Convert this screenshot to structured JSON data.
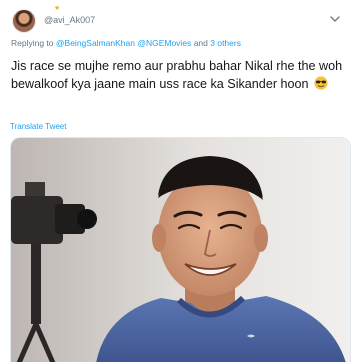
{
  "tweet": {
    "handle": "@avi_Ak007",
    "reply_prefix": "Replying to",
    "reply_user_1": "@BeingSalmanKhan",
    "reply_user_2": "@NGEMovies",
    "reply_and": "and",
    "reply_others": "3 others",
    "text": "Jis race se mujhe remo aur prabhu bahar Nikal rhe the woh bewalkoof kya jaane main uss race ka Sikander hoon",
    "emoji": "smiling-face-with-sunglasses",
    "translate_label": "Translate Tweet"
  },
  "icons": {
    "star": "star-icon",
    "more": "chevron-down-icon"
  },
  "colors": {
    "link": "#1da1f2",
    "secondary_text": "#657786",
    "sweater": "#4f6aa6",
    "background": "#ffffff"
  }
}
